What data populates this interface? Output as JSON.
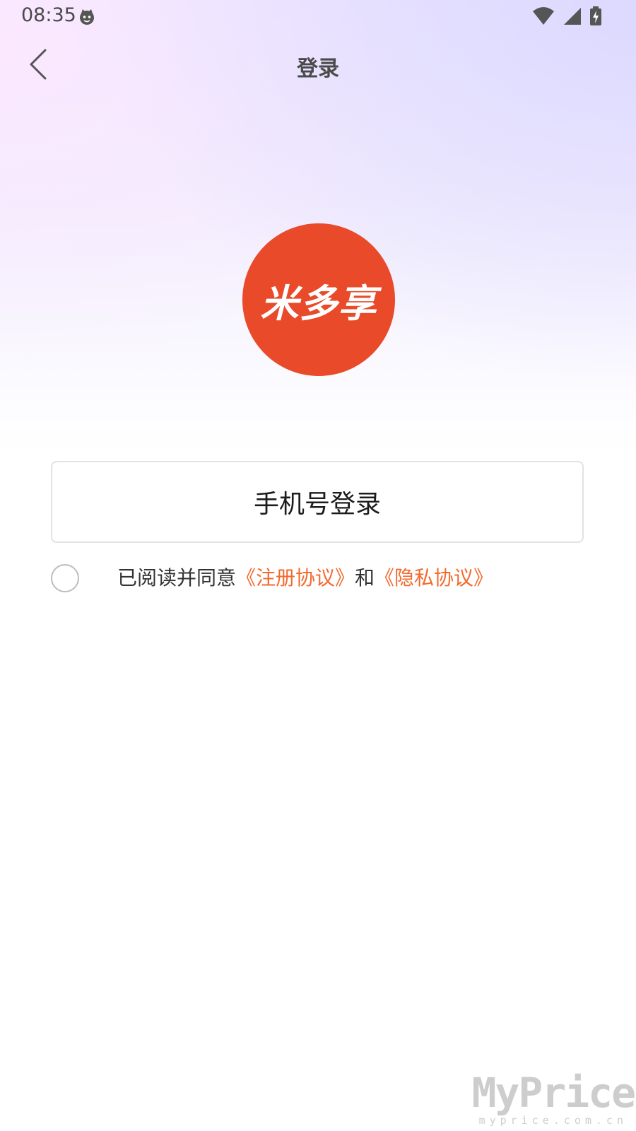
{
  "status_bar": {
    "time": "08:35",
    "icons": [
      "notification-face-icon",
      "wifi-icon",
      "cell-signal-icon",
      "battery-charging-icon"
    ]
  },
  "nav": {
    "back_icon": "chevron-left-icon",
    "title": "登录"
  },
  "logo": {
    "text": "米多享",
    "color": "#e84a2a"
  },
  "login": {
    "phone_button_label": "手机号登录"
  },
  "agreement": {
    "prefix": "已阅读并同意",
    "register_link": "《注册协议》",
    "and": "和",
    "privacy_link": "《隐私协议》",
    "checked": false,
    "link_color": "#f26a2e"
  },
  "watermark": {
    "logo": "MyPrice",
    "url": "myprice.com.cn"
  }
}
